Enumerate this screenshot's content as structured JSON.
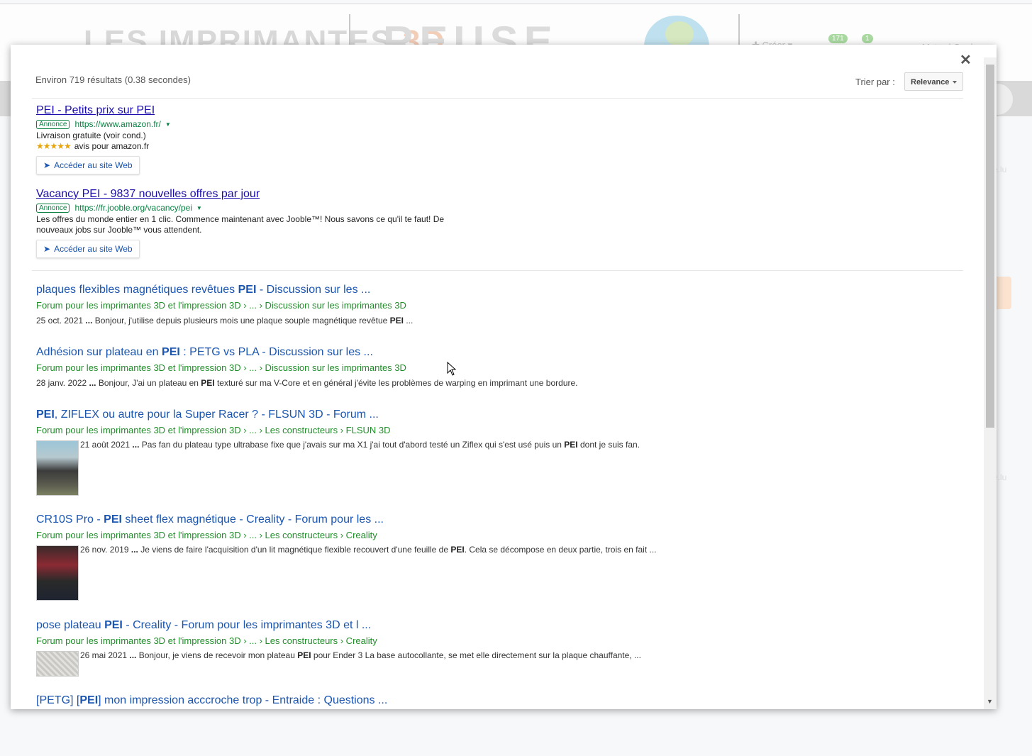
{
  "background": {
    "logo_left": "LES IMPRIMANTES",
    "logo_left_accent": "3D",
    "logo_center": "REUSE",
    "nav_create": "✚ Créer ▾",
    "badge_notifications": "171",
    "badge_messages": "1",
    "user_name": "Motard Geek ▾",
    "faint_text": "e.lu"
  },
  "modal": {
    "results_summary": "Environ 719 résultats (0.38 secondes)",
    "sort_label": "Trier par :",
    "sort_value": "Relevance",
    "ads": [
      {
        "title": "PEI - Petits prix sur PEI",
        "badge": "Annonce",
        "url": "https://www.amazon.fr/",
        "desc": "Livraison gratuite (voir cond.)",
        "rating_stars": "★★★★★",
        "rating_text": "avis pour amazon.fr",
        "button": "Accéder au site Web"
      },
      {
        "title": "Vacancy PEI - 9837 nouvelles offres par jour",
        "badge": "Annonce",
        "url": "https://fr.jooble.org/vacancy/pei",
        "desc": "Les offres du monde entier en 1 clic. Commence maintenant avec Jooble™! Nous savons ce qu'il te faut! De nouveaux jobs sur Jooble™ vous attendent.",
        "button": "Accéder au site Web"
      }
    ],
    "results": [
      {
        "title_pre": "plaques flexibles magnétiques revêtues ",
        "title_bold": "PEI",
        "title_post": " - Discussion sur les ...",
        "url": "Forum pour les imprimantes 3D et l'impression 3D › ... › Discussion sur les imprimantes 3D",
        "date": "25 oct. 2021",
        "snippet_pre": " Bonjour, j'utilise depuis plusieurs mois une plaque souple magnétique revêtue ",
        "snippet_bold": "PEI",
        "snippet_post": " ..."
      },
      {
        "title_pre": "Adhésion sur plateau en ",
        "title_bold": "PEI",
        "title_post": " : PETG vs PLA - Discussion sur les ...",
        "url": "Forum pour les imprimantes 3D et l'impression 3D › ... › Discussion sur les imprimantes 3D",
        "date": "28 janv. 2022",
        "snippet_pre": " Bonjour, J'ai un plateau en ",
        "snippet_bold": "PEI",
        "snippet_post": " texturé sur ma V-Core et en général j'évite les problèmes de warping en imprimant une bordure."
      },
      {
        "title_pre": "",
        "title_bold": "PEI",
        "title_post": ", ZIFLEX ou autre pour la Super Racer ? - FLSUN 3D - Forum ...",
        "url": "Forum pour les imprimantes 3D et l'impression 3D › ... › Les constructeurs › FLSUN 3D",
        "date": "21 août 2021",
        "snippet_pre": " Pas fan du plateau type ultrabase fixe que j'avais sur ma X1 j'ai tout d'abord testé un Ziflex qui s'est usé puis un ",
        "snippet_bold": "PEI",
        "snippet_post": " dont je suis fan."
      },
      {
        "title_pre": "CR10S Pro - ",
        "title_bold": "PEI",
        "title_post": " sheet flex magnétique - Creality - Forum pour les ...",
        "url": "Forum pour les imprimantes 3D et l'impression 3D › ... › Les constructeurs › Creality",
        "date": "26 nov. 2019",
        "snippet_pre": " Je viens de faire l'acquisition d'un lit magnétique flexible recouvert d'une feuille de ",
        "snippet_bold": "PEI",
        "snippet_post": ". Cela se décompose en deux partie, trois en fait ..."
      },
      {
        "title_pre": "pose plateau ",
        "title_bold": "PEI",
        "title_post": " - Creality - Forum pour les imprimantes 3D et l ...",
        "url": "Forum pour les imprimantes 3D et l'impression 3D › ... › Les constructeurs › Creality",
        "date": "26 mai 2021",
        "snippet_pre": " Bonjour, je viens de recevoir mon plateau ",
        "snippet_bold": "PEI",
        "snippet_post": " pour Ender 3 La base autocollante, se met elle directement sur la plaque chauffante, ..."
      },
      {
        "title_pre": "[PETG] [",
        "title_bold": "PEI",
        "title_post": "] mon impression acccroche trop - Entraide : Questions ..."
      }
    ],
    "ellipsis": "...",
    "close_glyph": "✕"
  },
  "colors": {
    "link": "#1a55b0",
    "ad_link": "#1a0dab",
    "url_green": "#218d2a",
    "star": "#e7a40b"
  }
}
